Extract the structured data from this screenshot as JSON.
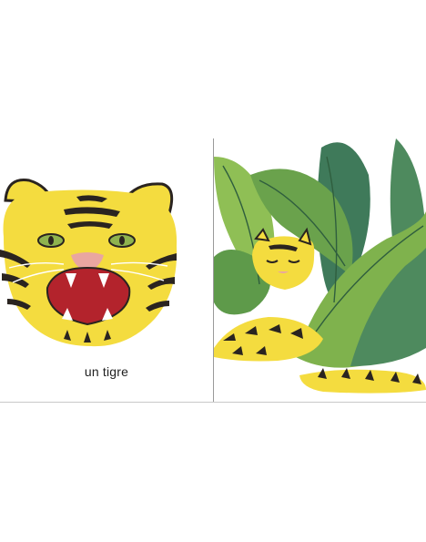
{
  "book_spread": {
    "left_page": {
      "caption": "un tigre"
    }
  },
  "palette": {
    "tiger_yellow": "#f4dc3f",
    "stripe": "#2a2420",
    "mouth_red": "#b3232c",
    "eye_green": "#8fb34e",
    "nose_pink": "#e9a6a0",
    "leaf_light": "#7fb24d",
    "leaf_mid": "#5e9a4a",
    "leaf_dark": "#3f7a5a"
  },
  "icons": {
    "left_illustration": "tiger-face-icon",
    "right_illustration": "sleeping-tiger-in-leaves-icon"
  }
}
